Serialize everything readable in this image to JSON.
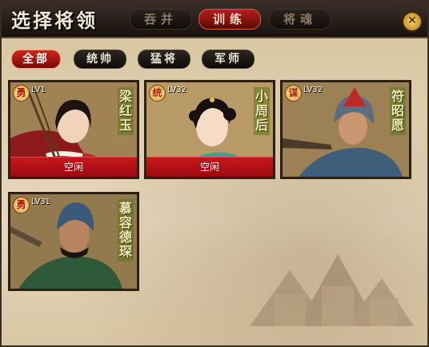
{
  "window": {
    "title": "选择将领",
    "tabs": [
      {
        "label": "吞并",
        "active": false
      },
      {
        "label": "训练",
        "active": true
      },
      {
        "label": "将魂",
        "active": false
      }
    ],
    "close_icon": "close-x-icon"
  },
  "filters": [
    {
      "label": "全部",
      "active": true
    },
    {
      "label": "统帅",
      "active": false
    },
    {
      "label": "猛将",
      "active": false
    },
    {
      "label": "军师",
      "active": false
    }
  ],
  "generals": [
    {
      "type": "勇",
      "level": "LV1",
      "name": "梁红玉",
      "status": "空闲",
      "palette": "red-archer"
    },
    {
      "type": "统",
      "level": "LV32",
      "name": "小周后",
      "status": "空闲",
      "palette": "teal-lady"
    },
    {
      "type": "谋",
      "level": "LV32",
      "name": "符昭愿",
      "status": "",
      "palette": "blue-helmet"
    },
    {
      "type": "勇",
      "level": "LV31",
      "name": "慕容德琛",
      "status": "",
      "palette": "green-warrior"
    }
  ],
  "colors": {
    "accent_red": "#c8161b",
    "panel_beige": "#dcc9a2",
    "titlebar_dark": "#17110d"
  }
}
